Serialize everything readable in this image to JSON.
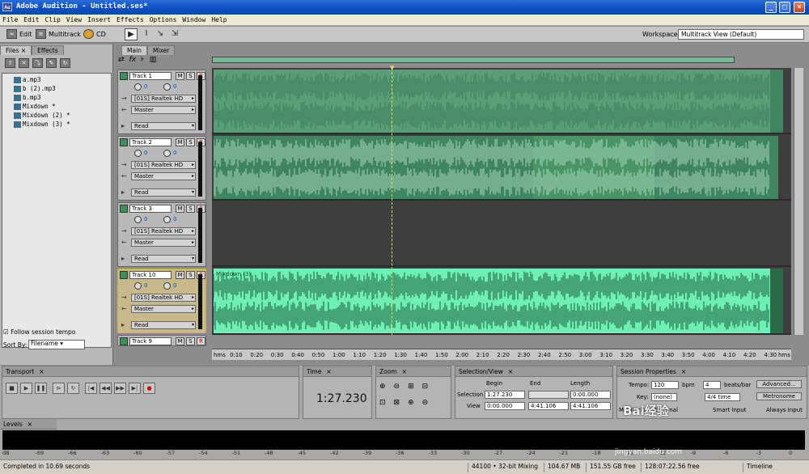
{
  "app": {
    "title": "Adobe Audition - Untitled.ses*",
    "icon_text": "Au"
  },
  "window_buttons": [
    "_",
    "□",
    "×"
  ],
  "menu": [
    "File",
    "Edit",
    "Clip",
    "View",
    "Insert",
    "Effects",
    "Options",
    "Window",
    "Help"
  ],
  "toolbar": {
    "edit_label": "Edit",
    "multitrack_label": "Multitrack",
    "cd_label": "CD",
    "workspace_label": "Workspace:",
    "workspace_value": "Multitrack View (Default)"
  },
  "left_panel": {
    "tabs": [
      "Files",
      "Effects"
    ],
    "files": [
      "a.mp3",
      "b (2).mp3",
      "b.mp3",
      "Mixdown *",
      "Mixdown (2) *",
      "Mixdown (3) *"
    ],
    "follow_tempo": "Follow session tempo",
    "sort_by_label": "Sort By:",
    "sort_by_value": "Filename"
  },
  "main_tabs": [
    "Main",
    "Mixer"
  ],
  "tracks": [
    {
      "name": "Track 1",
      "vol": "0",
      "pan": "0",
      "output": "[01S] Realtek HD",
      "bus": "Master",
      "mode": "Read"
    },
    {
      "name": "Track 2",
      "vol": "0",
      "pan": "0",
      "output": "[01S] Realtek HD",
      "bus": "Master",
      "mode": "Read"
    },
    {
      "name": "Track 3",
      "vol": "0",
      "pan": "0",
      "output": "[01S] Realtek HD",
      "bus": "Master",
      "mode": "Read"
    },
    {
      "name": "Track 10",
      "vol": "0",
      "pan": "0",
      "output": "[01S] Realtek HD",
      "bus": "Master",
      "mode": "Read"
    },
    {
      "name": "Track 9"
    }
  ],
  "msr": [
    "M",
    "S",
    "R"
  ],
  "clip_label": "Mixdown (3)",
  "ruler": [
    "hms",
    "0:10",
    "0:20",
    "0:30",
    "0:40",
    "0:50",
    "1:00",
    "1:10",
    "1:20",
    "1:30",
    "1:40",
    "1:50",
    "2:00",
    "2:10",
    "2:20",
    "2:30",
    "2:40",
    "2:50",
    "3:00",
    "3:10",
    "3:20",
    "3:30",
    "3:40",
    "3:50",
    "4:00",
    "4:10",
    "4:20",
    "4:30",
    "hms"
  ],
  "panels": {
    "transport": "Transport",
    "time": "Time",
    "time_value": "1:27.230",
    "zoom": "Zoom",
    "selection": {
      "title": "Selection/View",
      "begin": "Begin",
      "end": "End",
      "length": "Length",
      "sel_label": "Selection",
      "view_label": "View",
      "sel_begin": "1:27.230",
      "sel_end": "",
      "sel_length": "0:00.000",
      "view_begin": "0:00.000",
      "view_end": "4:41.106",
      "view_length": "4:41.106"
    },
    "session": {
      "title": "Session Properties",
      "tempo_label": "Tempo:",
      "tempo": "120",
      "bpm": "bpm",
      "beats": "4",
      "beats_label": "beats/bar",
      "advanced": "Advanced...",
      "key_label": "Key:",
      "key": "(none)",
      "time_sig": "4/4 time",
      "metronome": "Metronome",
      "monitoring_label": "Monitoring:",
      "external": "External",
      "smart_input": "Smart Input",
      "always_input": "Always Input"
    }
  },
  "levels": {
    "title": "Levels",
    "scale": [
      "dB",
      "-69",
      "-66",
      "-63",
      "-60",
      "-57",
      "-54",
      "-51",
      "-48",
      "-45",
      "-42",
      "-39",
      "-36",
      "-33",
      "-30",
      "-27",
      "-24",
      "-21",
      "-18",
      "-15",
      "-12",
      "-9",
      "-6",
      "-3",
      "0"
    ]
  },
  "status": {
    "message": "Completed in 10.69 seconds",
    "format": "44100 • 32-bit Mixing",
    "mem": "104.67 MB",
    "disk": "151.55 GB free",
    "time_free": "128:07:22.56 free",
    "mode": "Timeline"
  },
  "watermark": {
    "text": "Bai经验",
    "url": "jingyan.baidu.com"
  },
  "colors": {
    "clip_dark": "#3f8560",
    "clip_mid": "#5a9e78",
    "clip_bright": "#6ef0b4",
    "selected_track": "#d8b040"
  }
}
